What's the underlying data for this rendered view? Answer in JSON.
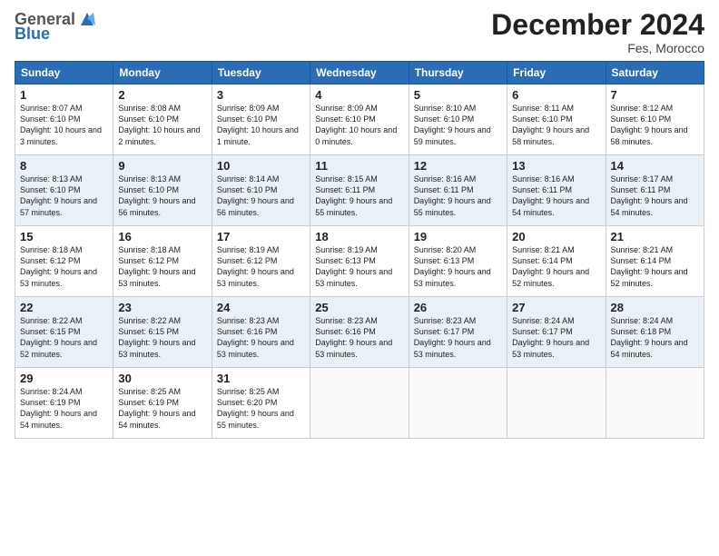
{
  "header": {
    "logo_general": "General",
    "logo_blue": "Blue",
    "month_title": "December 2024",
    "location": "Fes, Morocco"
  },
  "days_of_week": [
    "Sunday",
    "Monday",
    "Tuesday",
    "Wednesday",
    "Thursday",
    "Friday",
    "Saturday"
  ],
  "weeks": [
    [
      {
        "day": "1",
        "sunrise": "Sunrise: 8:07 AM",
        "sunset": "Sunset: 6:10 PM",
        "daylight": "Daylight: 10 hours and 3 minutes."
      },
      {
        "day": "2",
        "sunrise": "Sunrise: 8:08 AM",
        "sunset": "Sunset: 6:10 PM",
        "daylight": "Daylight: 10 hours and 2 minutes."
      },
      {
        "day": "3",
        "sunrise": "Sunrise: 8:09 AM",
        "sunset": "Sunset: 6:10 PM",
        "daylight": "Daylight: 10 hours and 1 minute."
      },
      {
        "day": "4",
        "sunrise": "Sunrise: 8:09 AM",
        "sunset": "Sunset: 6:10 PM",
        "daylight": "Daylight: 10 hours and 0 minutes."
      },
      {
        "day": "5",
        "sunrise": "Sunrise: 8:10 AM",
        "sunset": "Sunset: 6:10 PM",
        "daylight": "Daylight: 9 hours and 59 minutes."
      },
      {
        "day": "6",
        "sunrise": "Sunrise: 8:11 AM",
        "sunset": "Sunset: 6:10 PM",
        "daylight": "Daylight: 9 hours and 58 minutes."
      },
      {
        "day": "7",
        "sunrise": "Sunrise: 8:12 AM",
        "sunset": "Sunset: 6:10 PM",
        "daylight": "Daylight: 9 hours and 58 minutes."
      }
    ],
    [
      {
        "day": "8",
        "sunrise": "Sunrise: 8:13 AM",
        "sunset": "Sunset: 6:10 PM",
        "daylight": "Daylight: 9 hours and 57 minutes."
      },
      {
        "day": "9",
        "sunrise": "Sunrise: 8:13 AM",
        "sunset": "Sunset: 6:10 PM",
        "daylight": "Daylight: 9 hours and 56 minutes."
      },
      {
        "day": "10",
        "sunrise": "Sunrise: 8:14 AM",
        "sunset": "Sunset: 6:10 PM",
        "daylight": "Daylight: 9 hours and 56 minutes."
      },
      {
        "day": "11",
        "sunrise": "Sunrise: 8:15 AM",
        "sunset": "Sunset: 6:11 PM",
        "daylight": "Daylight: 9 hours and 55 minutes."
      },
      {
        "day": "12",
        "sunrise": "Sunrise: 8:16 AM",
        "sunset": "Sunset: 6:11 PM",
        "daylight": "Daylight: 9 hours and 55 minutes."
      },
      {
        "day": "13",
        "sunrise": "Sunrise: 8:16 AM",
        "sunset": "Sunset: 6:11 PM",
        "daylight": "Daylight: 9 hours and 54 minutes."
      },
      {
        "day": "14",
        "sunrise": "Sunrise: 8:17 AM",
        "sunset": "Sunset: 6:11 PM",
        "daylight": "Daylight: 9 hours and 54 minutes."
      }
    ],
    [
      {
        "day": "15",
        "sunrise": "Sunrise: 8:18 AM",
        "sunset": "Sunset: 6:12 PM",
        "daylight": "Daylight: 9 hours and 53 minutes."
      },
      {
        "day": "16",
        "sunrise": "Sunrise: 8:18 AM",
        "sunset": "Sunset: 6:12 PM",
        "daylight": "Daylight: 9 hours and 53 minutes."
      },
      {
        "day": "17",
        "sunrise": "Sunrise: 8:19 AM",
        "sunset": "Sunset: 6:12 PM",
        "daylight": "Daylight: 9 hours and 53 minutes."
      },
      {
        "day": "18",
        "sunrise": "Sunrise: 8:19 AM",
        "sunset": "Sunset: 6:13 PM",
        "daylight": "Daylight: 9 hours and 53 minutes."
      },
      {
        "day": "19",
        "sunrise": "Sunrise: 8:20 AM",
        "sunset": "Sunset: 6:13 PM",
        "daylight": "Daylight: 9 hours and 53 minutes."
      },
      {
        "day": "20",
        "sunrise": "Sunrise: 8:21 AM",
        "sunset": "Sunset: 6:14 PM",
        "daylight": "Daylight: 9 hours and 52 minutes."
      },
      {
        "day": "21",
        "sunrise": "Sunrise: 8:21 AM",
        "sunset": "Sunset: 6:14 PM",
        "daylight": "Daylight: 9 hours and 52 minutes."
      }
    ],
    [
      {
        "day": "22",
        "sunrise": "Sunrise: 8:22 AM",
        "sunset": "Sunset: 6:15 PM",
        "daylight": "Daylight: 9 hours and 52 minutes."
      },
      {
        "day": "23",
        "sunrise": "Sunrise: 8:22 AM",
        "sunset": "Sunset: 6:15 PM",
        "daylight": "Daylight: 9 hours and 53 minutes."
      },
      {
        "day": "24",
        "sunrise": "Sunrise: 8:23 AM",
        "sunset": "Sunset: 6:16 PM",
        "daylight": "Daylight: 9 hours and 53 minutes."
      },
      {
        "day": "25",
        "sunrise": "Sunrise: 8:23 AM",
        "sunset": "Sunset: 6:16 PM",
        "daylight": "Daylight: 9 hours and 53 minutes."
      },
      {
        "day": "26",
        "sunrise": "Sunrise: 8:23 AM",
        "sunset": "Sunset: 6:17 PM",
        "daylight": "Daylight: 9 hours and 53 minutes."
      },
      {
        "day": "27",
        "sunrise": "Sunrise: 8:24 AM",
        "sunset": "Sunset: 6:17 PM",
        "daylight": "Daylight: 9 hours and 53 minutes."
      },
      {
        "day": "28",
        "sunrise": "Sunrise: 8:24 AM",
        "sunset": "Sunset: 6:18 PM",
        "daylight": "Daylight: 9 hours and 54 minutes."
      }
    ],
    [
      {
        "day": "29",
        "sunrise": "Sunrise: 8:24 AM",
        "sunset": "Sunset: 6:19 PM",
        "daylight": "Daylight: 9 hours and 54 minutes."
      },
      {
        "day": "30",
        "sunrise": "Sunrise: 8:25 AM",
        "sunset": "Sunset: 6:19 PM",
        "daylight": "Daylight: 9 hours and 54 minutes."
      },
      {
        "day": "31",
        "sunrise": "Sunrise: 8:25 AM",
        "sunset": "Sunset: 6:20 PM",
        "daylight": "Daylight: 9 hours and 55 minutes."
      },
      null,
      null,
      null,
      null
    ]
  ]
}
